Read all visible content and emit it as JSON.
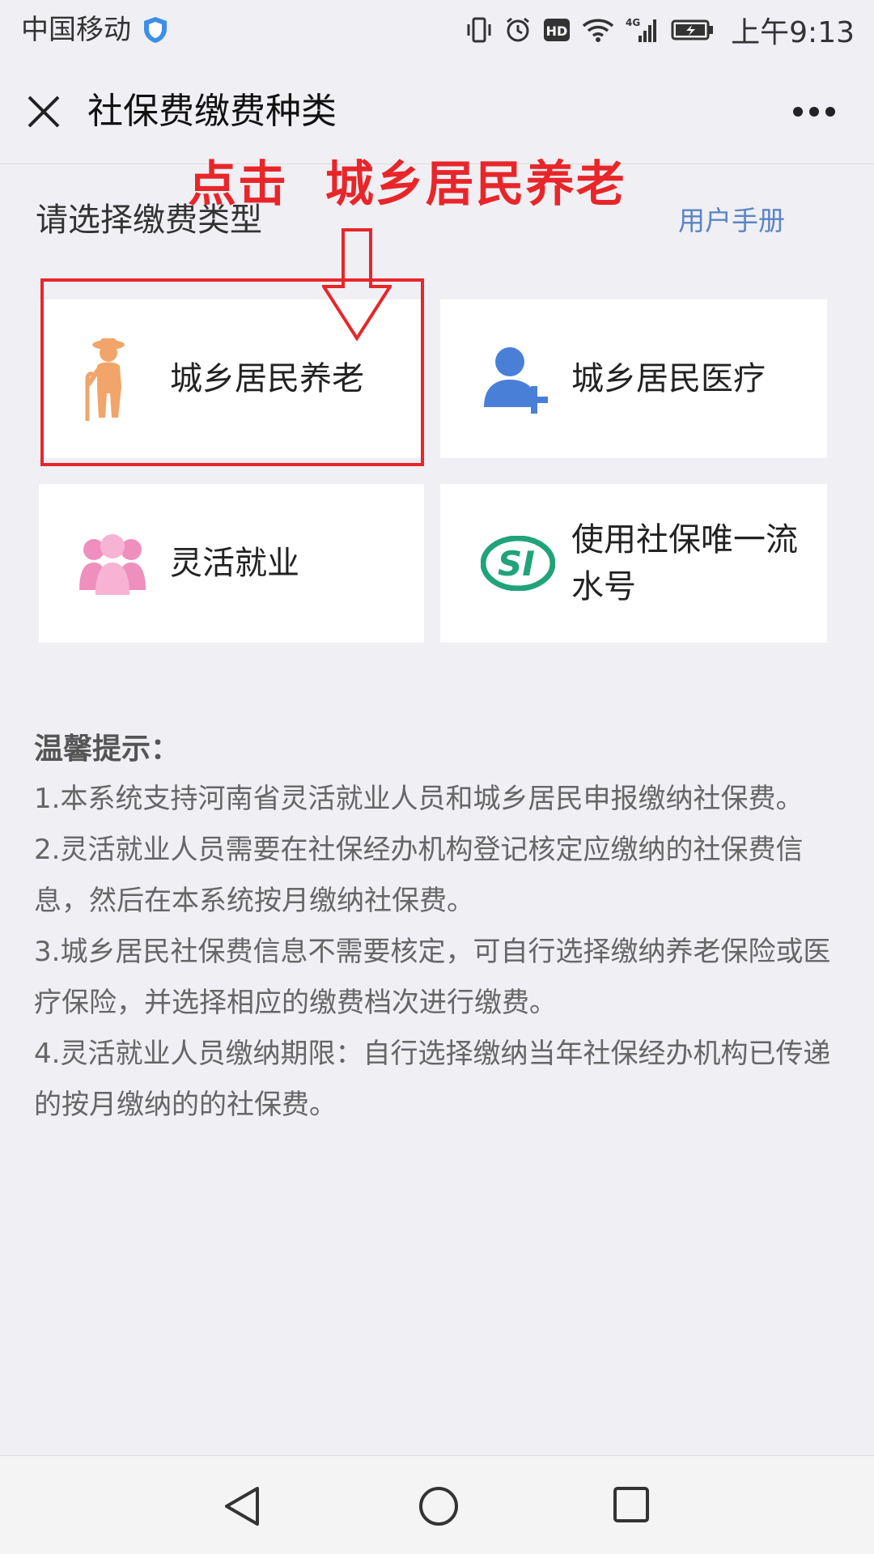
{
  "status_bar": {
    "carrier": "中国移动",
    "network": "4G",
    "time": "上午9:13"
  },
  "nav": {
    "title": "社保费缴费种类"
  },
  "annotation": {
    "text": "点击  城乡居民养老"
  },
  "section": {
    "label": "请选择缴费类型",
    "manual_link": "用户手册"
  },
  "cards": [
    {
      "label": "城乡居民养老",
      "icon": "elderly-person-icon"
    },
    {
      "label": "城乡居民医疗",
      "icon": "user-add-icon"
    },
    {
      "label": "灵活就业",
      "icon": "people-group-icon"
    },
    {
      "label": "使用社保唯一流水号",
      "icon": "si-logo-icon"
    }
  ],
  "tips": {
    "title": "温馨提示：",
    "items": [
      "1.本系统支持河南省灵活就业人员和城乡居民申报缴纳社保费。",
      "2.灵活就业人员需要在社保经办机构登记核定应缴纳的社保费信息，然后在本系统按月缴纳社保费。",
      "3.城乡居民社保费信息不需要核定，可自行选择缴纳养老保险或医疗保险，并选择相应的缴费档次进行缴费。",
      "4.灵活就业人员缴纳期限：自行选择缴纳当年社保经办机构已传递的按月缴纳的的社保费。"
    ]
  },
  "colors": {
    "background": "#efeff4",
    "annotation_red": "#e8262a",
    "link_blue": "#5b84c4",
    "elderly_orange": "#f2a56b",
    "medical_blue": "#4a7fd8",
    "people_pink": "#ef8fbe",
    "si_green": "#21a37a"
  }
}
